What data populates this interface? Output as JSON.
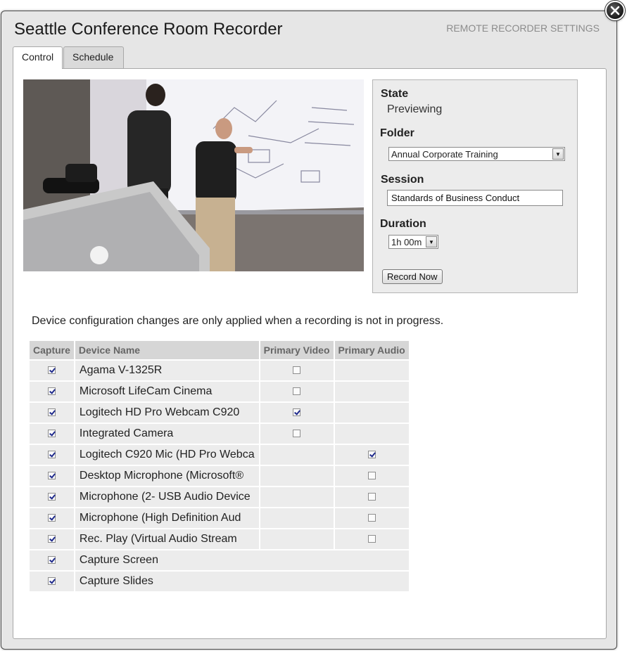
{
  "dialog": {
    "title": "Seattle Conference Room Recorder",
    "settings_link": "REMOTE RECORDER SETTINGS",
    "close_icon": "close-icon"
  },
  "tabs": [
    {
      "label": "Control",
      "active": true
    },
    {
      "label": "Schedule",
      "active": false
    }
  ],
  "status": {
    "state_label": "State",
    "state_value": "Previewing",
    "folder_label": "Folder",
    "folder_value": "Annual Corporate Training",
    "session_label": "Session",
    "session_value": "Standards of Business Conduct",
    "duration_label": "Duration",
    "duration_value": "1h 00m",
    "record_button": "Record Now"
  },
  "notice": "Device configuration changes are only applied when a recording is not in progress.",
  "devices": {
    "headers": [
      "Capture",
      "Device Name",
      "Primary Video",
      "Primary Audio"
    ],
    "rows": [
      {
        "name": "Agama V-1325R",
        "capture": true,
        "video": false,
        "audio": null
      },
      {
        "name": "Microsoft LifeCam Cinema",
        "capture": true,
        "video": false,
        "audio": null
      },
      {
        "name": "Logitech HD Pro Webcam C920",
        "capture": true,
        "video": true,
        "audio": null
      },
      {
        "name": "Integrated Camera",
        "capture": true,
        "video": false,
        "audio": null
      },
      {
        "name": "Logitech C920 Mic (HD Pro Webca",
        "capture": true,
        "video": null,
        "audio": true
      },
      {
        "name": "Desktop Microphone (Microsoft®",
        "capture": true,
        "video": null,
        "audio": false
      },
      {
        "name": "Microphone (2- USB Audio Device",
        "capture": true,
        "video": null,
        "audio": false
      },
      {
        "name": "Microphone (High Definition Aud",
        "capture": true,
        "video": null,
        "audio": false
      },
      {
        "name": "Rec. Play (Virtual Audio Stream",
        "capture": true,
        "video": null,
        "audio": false
      },
      {
        "name": "Capture Screen",
        "capture": true,
        "video": null,
        "audio": null,
        "merged": true
      },
      {
        "name": "Capture Slides",
        "capture": true,
        "video": null,
        "audio": null,
        "merged": true
      }
    ]
  },
  "colors": {
    "dialog_bg": "#e6e6e6",
    "panel_bg": "#ffffff",
    "header_bg": "#d6d6d6",
    "row_bg": "#ececec",
    "check_color": "#1f2a8c"
  }
}
